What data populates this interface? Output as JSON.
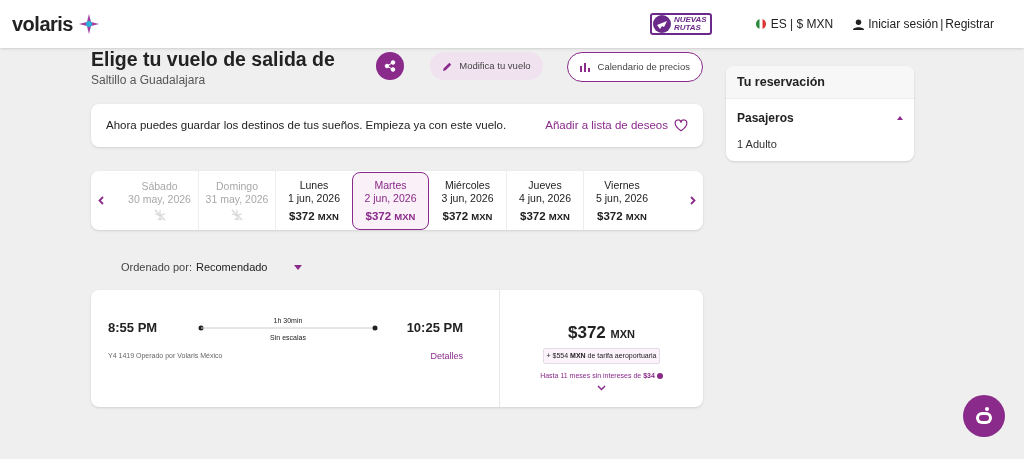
{
  "header": {
    "brand": "volaris",
    "promo": [
      "NUEVAS",
      "RUTAS"
    ],
    "locale": "ES | $ MXN",
    "login": "Iniciar sesión",
    "separator": "|",
    "register": "Registrar"
  },
  "title": "Elige tu vuelo de salida de",
  "route": "Saltillo a Guadalajara",
  "actions": {
    "modify": "Modifica tu vuelo",
    "calendar": "Calendario de precios"
  },
  "notice": {
    "text": "Ahora puedes guardar los destinos de tus sueños. Empieza ya con este vuelo.",
    "link": "Añadir a lista de deseos"
  },
  "days": [
    {
      "day": "Sábado",
      "date": "30 may, 2026",
      "disabled": true,
      "selected": false
    },
    {
      "day": "Domingo",
      "date": "31 may, 2026",
      "disabled": true,
      "selected": false
    },
    {
      "day": "Lunes",
      "date": "1 jun, 2026",
      "price": "$372",
      "currency": "MXN",
      "disabled": false,
      "selected": false
    },
    {
      "day": "Martes",
      "date": "2 jun, 2026",
      "price": "$372",
      "currency": "MXN",
      "disabled": false,
      "selected": true
    },
    {
      "day": "Miércoles",
      "date": "3 jun, 2026",
      "price": "$372",
      "currency": "MXN",
      "disabled": false,
      "selected": false
    },
    {
      "day": "Jueves",
      "date": "4 jun, 2026",
      "price": "$372",
      "currency": "MXN",
      "disabled": false,
      "selected": false
    },
    {
      "day": "Viernes",
      "date": "5 jun, 2026",
      "price": "$372",
      "currency": "MXN",
      "disabled": false,
      "selected": false
    }
  ],
  "sort": {
    "label": "Ordenado por:",
    "value": "Recomendado"
  },
  "flight": {
    "depart": "8:55 PM",
    "arrive": "10:25 PM",
    "duration": "1h 30min",
    "stops": "Sin escalas",
    "operator": "Y4 1419 Operado por Volaris México",
    "details": "Detalles",
    "price": "$372",
    "currency": "MXN",
    "fee": "+ $554 **MXN** de tarifa aeroportuaria",
    "installments": "Hasta 11 meses sin intereses de **$34**"
  },
  "reservation": {
    "title": "Tu reservación",
    "section": "Pasajeros",
    "expanded": true,
    "passengers": "1 Adulto"
  }
}
